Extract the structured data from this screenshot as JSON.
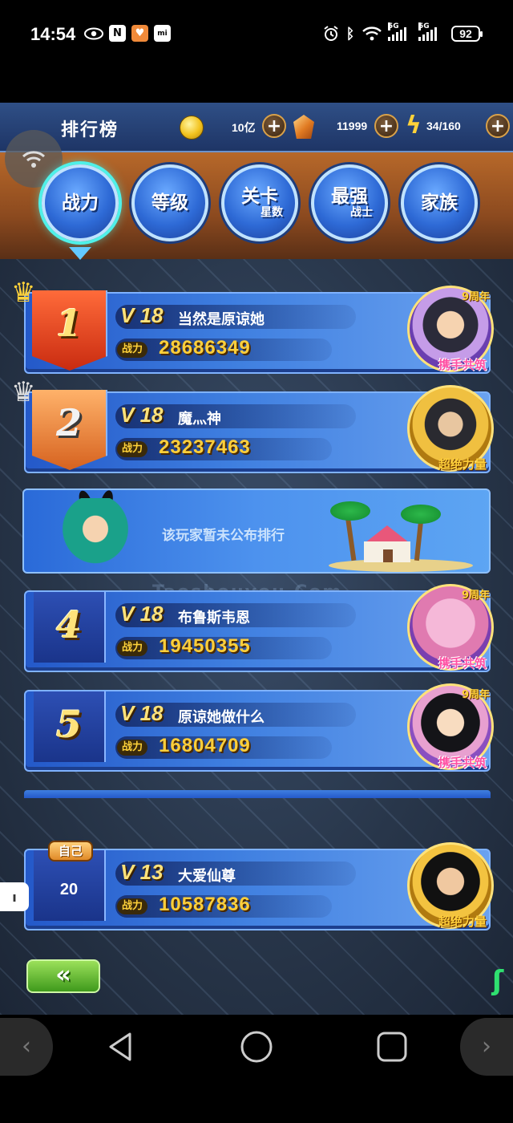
{
  "status_bar": {
    "time": "14:54",
    "network_1": "5G",
    "network_2": "5G",
    "battery": "92",
    "icons": [
      "eye-icon",
      "nfc-icon",
      "app-notification-icon",
      "mi-icon",
      "alarm-icon",
      "bluetooth-icon",
      "wifi-icon"
    ]
  },
  "header": {
    "title": "排行榜",
    "gold": "10亿",
    "crystal": "11999",
    "stamina": "34/160",
    "plus": "+"
  },
  "tabs": [
    {
      "label": "战力",
      "sub": "",
      "active": true
    },
    {
      "label": "等级",
      "sub": "",
      "active": false
    },
    {
      "label": "关卡",
      "sub": "星数",
      "active": false
    },
    {
      "label": "最强",
      "sub": "战士",
      "active": false
    },
    {
      "label": "家族",
      "sub": "",
      "active": false
    }
  ],
  "rankings": [
    {
      "rank": "1",
      "vip": "V 18",
      "name": "当然是原谅她",
      "power_label": "战力",
      "power": "28686349",
      "anniversary": "9周年",
      "badge": "携手共筑"
    },
    {
      "rank": "2",
      "vip": "V 18",
      "name": "魔灬神",
      "power_label": "战力",
      "power": "23237463",
      "anniversary": "",
      "badge": "超绝力量"
    },
    {
      "rank": "4",
      "vip": "V 18",
      "name": "布鲁斯韦恩",
      "power_label": "战力",
      "power": "19450355",
      "anniversary": "9周年",
      "badge": "携手共筑"
    },
    {
      "rank": "5",
      "vip": "V 18",
      "name": "原谅她做什么",
      "power_label": "战力",
      "power": "16804709",
      "anniversary": "9周年",
      "badge": "携手共筑"
    }
  ],
  "hidden_banner": {
    "text": "该玩家暂未公布排行"
  },
  "watermark": "Taoshouyou.Com",
  "self": {
    "tag": "自己",
    "rank": "20",
    "vip": "V 13",
    "name": "大爱仙尊",
    "power_label": "战力",
    "power": "10587836",
    "badge": "超绝力量"
  },
  "back_button": "«",
  "colors": {
    "panel_blue": "#3f7fe0",
    "gold_text": "#ffcf3a",
    "active_tab_glow": "#4ff0e8",
    "orange_band": "#b8692a"
  }
}
